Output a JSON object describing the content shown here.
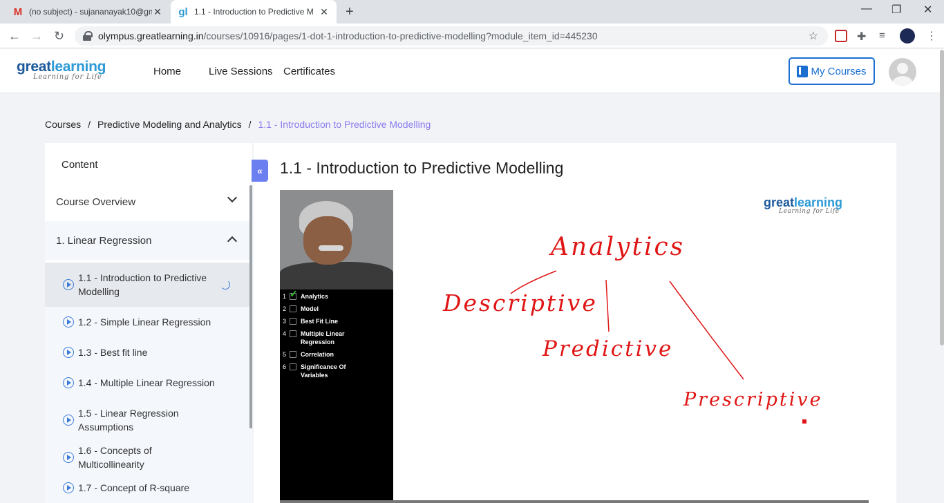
{
  "browser": {
    "tabs": [
      {
        "title": "(no subject) - sujananayak10@gm",
        "favicon": "gmail-icon",
        "active": false
      },
      {
        "title": "1.1 - Introduction to Predictive M",
        "favicon": "greatlearning-icon",
        "active": true
      }
    ],
    "url_host": "olympus.greatlearning.in",
    "url_path": "/courses/10916/pages/1-dot-1-introduction-to-predictive-modelling?module_item_id=445230"
  },
  "header": {
    "logo_main_a": "great",
    "logo_main_b": "learning",
    "logo_tagline": "Learning for Life",
    "nav": [
      "Home",
      "Live Sessions",
      "Certificates"
    ],
    "my_courses": "My Courses"
  },
  "breadcrumb": {
    "items": [
      "Courses",
      "Predictive Modeling and Analytics"
    ],
    "current": "1.1 - Introduction to Predictive Modelling",
    "sep": "/"
  },
  "sidebar": {
    "heading": "Content",
    "sections": [
      {
        "label": "Course Overview",
        "expanded": false
      },
      {
        "label": "1. Linear Regression",
        "expanded": true
      }
    ],
    "items": [
      {
        "label": "1.1 - Introduction to Predictive Modelling",
        "active": true
      },
      {
        "label": "1.2 - Simple Linear Regression",
        "active": false
      },
      {
        "label": "1.3 - Best fit line",
        "active": false
      },
      {
        "label": "1.4 - Multiple Linear Regression",
        "active": false
      },
      {
        "label": "1.5 - Linear Regression Assumptions",
        "active": false
      },
      {
        "label": "1.6 - Concepts of Multicollinearity",
        "active": false
      },
      {
        "label": "1.7 - Concept of R-square",
        "active": false
      }
    ],
    "collapse_glyph": "«"
  },
  "main": {
    "title": "1.1 - Introduction to Predictive Modelling",
    "video": {
      "checklist": [
        {
          "n": "1",
          "label": "Analytics",
          "done": true
        },
        {
          "n": "2",
          "label": "Model",
          "done": false
        },
        {
          "n": "3",
          "label": "Best Fit Line",
          "done": false
        },
        {
          "n": "4",
          "label": "Multiple Linear Regression",
          "done": false
        },
        {
          "n": "5",
          "label": "Correlation",
          "done": false
        },
        {
          "n": "6",
          "label": "Significance Of Variables",
          "done": false
        }
      ],
      "board_words": {
        "top": "Analytics",
        "left": "Descriptive",
        "middle": "Predictive",
        "right": "Prescriptive"
      }
    }
  },
  "colors": {
    "accent": "#1a6fd1",
    "breadcrumb_current": "#8a7cf0",
    "collapse_button": "#6c7ff0",
    "ink": "#e01515"
  }
}
